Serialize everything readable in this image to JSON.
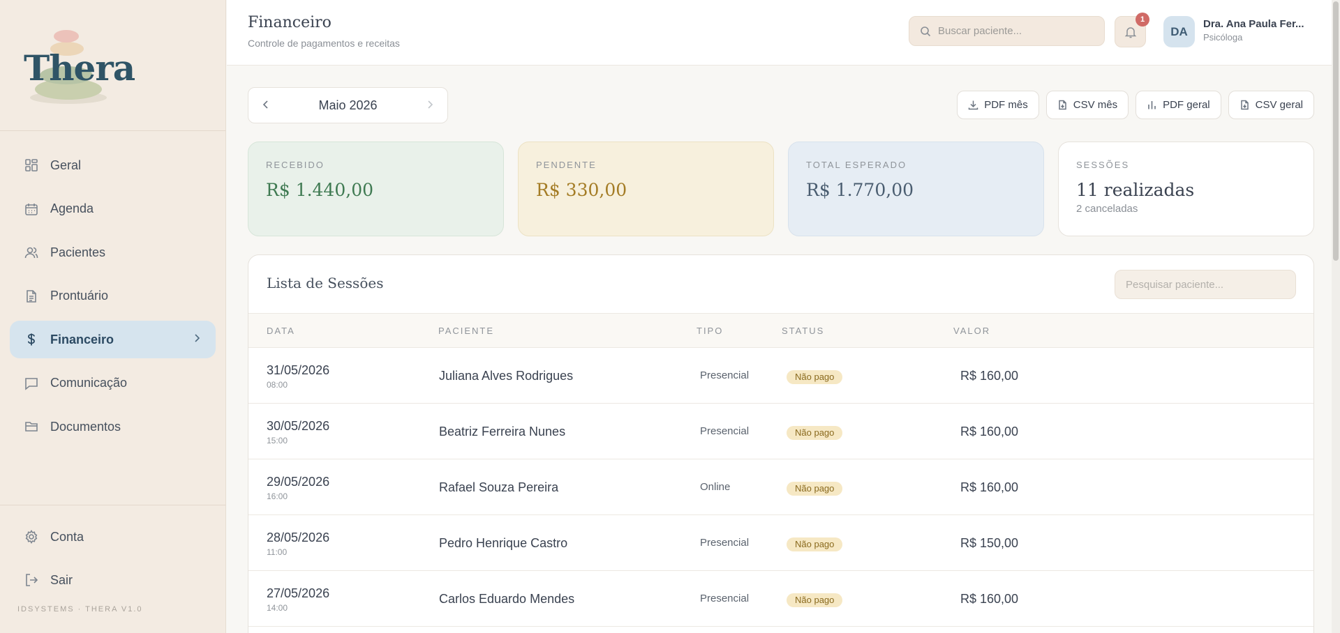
{
  "sidebar": {
    "logo_text": "Thera",
    "items": [
      {
        "label": "Geral",
        "icon": "grid-icon"
      },
      {
        "label": "Agenda",
        "icon": "calendar-icon"
      },
      {
        "label": "Pacientes",
        "icon": "users-icon"
      },
      {
        "label": "Prontuário",
        "icon": "document-icon"
      },
      {
        "label": "Financeiro",
        "icon": "dollar-icon",
        "active": true
      },
      {
        "label": "Comunicação",
        "icon": "message-icon"
      },
      {
        "label": "Documentos",
        "icon": "folder-icon"
      }
    ],
    "bottom_items": [
      {
        "label": "Conta",
        "icon": "gear-icon"
      },
      {
        "label": "Sair",
        "icon": "logout-icon"
      }
    ],
    "version": "IDSYSTEMS · THERA V1.0"
  },
  "header": {
    "title": "Financeiro",
    "subtitle": "Controle de pagamentos e receitas",
    "search_placeholder": "Buscar paciente...",
    "notifications_count": "1",
    "avatar_initials": "DA",
    "user_name": "Dra. Ana Paula Fer...",
    "user_role": "Psicóloga"
  },
  "month_selector": {
    "label": "Maio 2026"
  },
  "exports": [
    {
      "label": "PDF mês",
      "icon": "download-icon"
    },
    {
      "label": "CSV mês",
      "icon": "file-icon"
    },
    {
      "label": "PDF geral",
      "icon": "bar-chart-icon"
    },
    {
      "label": "CSV geral",
      "icon": "file-icon"
    }
  ],
  "kpis": {
    "received": {
      "label": "RECEBIDO",
      "value": "R$ 1.440,00"
    },
    "pending": {
      "label": "PENDENTE",
      "value": "R$ 330,00"
    },
    "expected": {
      "label": "TOTAL ESPERADO",
      "value": "R$ 1.770,00"
    },
    "sessions": {
      "label": "SESSÕES",
      "value": "11 realizadas",
      "sub": "2 canceladas"
    }
  },
  "sessions": {
    "title": "Lista de Sessões",
    "search_placeholder": "Pesquisar paciente...",
    "columns": [
      "DATA",
      "PACIENTE",
      "TIPO",
      "STATUS",
      "VALOR"
    ],
    "rows": [
      {
        "date": "31/05/2026",
        "time": "08:00",
        "patient": "Juliana Alves Rodrigues",
        "type": "Presencial",
        "status": "Não pago",
        "value": "R$ 160,00"
      },
      {
        "date": "30/05/2026",
        "time": "15:00",
        "patient": "Beatriz Ferreira Nunes",
        "type": "Presencial",
        "status": "Não pago",
        "value": "R$ 160,00"
      },
      {
        "date": "29/05/2026",
        "time": "16:00",
        "patient": "Rafael Souza Pereira",
        "type": "Online",
        "status": "Não pago",
        "value": "R$ 160,00"
      },
      {
        "date": "28/05/2026",
        "time": "11:00",
        "patient": "Pedro Henrique Castro",
        "type": "Presencial",
        "status": "Não pago",
        "value": "R$ 150,00"
      },
      {
        "date": "27/05/2026",
        "time": "14:00",
        "patient": "Carlos Eduardo Mendes",
        "type": "Presencial",
        "status": "Não pago",
        "value": "R$ 160,00"
      }
    ]
  },
  "colors": {
    "accent": "#2c4a63",
    "active_nav_bg": "#d6e4ee",
    "received": "#3f7a52",
    "pending": "#a47c25",
    "status_unpaid_bg": "#f6e8c4"
  }
}
